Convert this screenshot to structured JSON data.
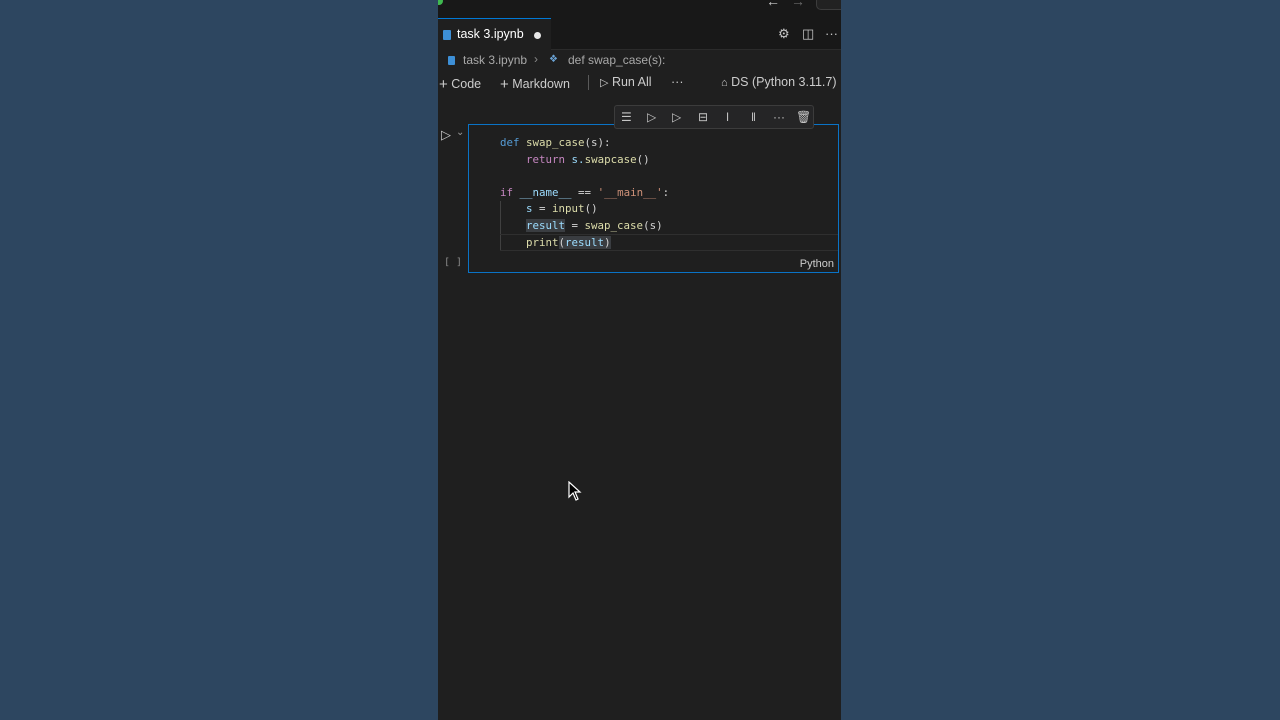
{
  "tab": {
    "filename": "task 3.ipynb"
  },
  "breadcrumb": {
    "file": "task 3.ipynb",
    "symbol": "def swap_case(s):"
  },
  "toolbar": {
    "code_label": "Code",
    "markdown_label": "Markdown",
    "run_all_label": "Run All",
    "more_label": "···",
    "kernel_label": "DS (Python 3.11.7)"
  },
  "cell": {
    "language": "Python",
    "exec_count": "[ ]",
    "code": {
      "l1_kw": "def",
      "l1_fn": "swap_case",
      "l1_rest": "(s):",
      "l2_kw": "return",
      "l2_obj": "s.",
      "l2_fn": "swapcase",
      "l2_rest": "()",
      "l4_kw": "if",
      "l4_var": "__name__",
      "l4_op": " == ",
      "l4_str": "'__main__'",
      "l4_end": ":",
      "l5_var": "s",
      "l5_op": " = ",
      "l5_fn": "input",
      "l5_rest": "()",
      "l6_var": "result",
      "l6_op": " = ",
      "l6_fn": "swap_case",
      "l6_rest": "(s)",
      "l7_fn": "print",
      "l7_open": "(",
      "l7_var": "result",
      "l7_close": ")"
    }
  },
  "icons": [
    "close-dot-icon",
    "gear-icon",
    "split-editor-icon",
    "more-icon",
    "run-icon",
    "plus-icon",
    "kernel-icon",
    "delete-icon"
  ]
}
